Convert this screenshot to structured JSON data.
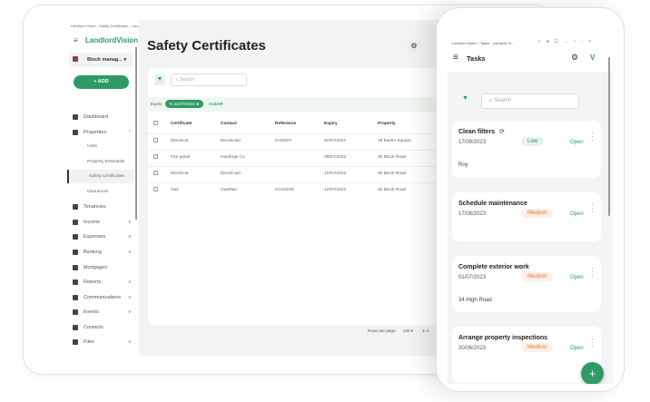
{
  "colors": {
    "accent": "#2f9a66",
    "medium": "#e07a3a"
  },
  "tablet": {
    "window_title": "Landlord Vision - Safety Certificates - Landlord Vision",
    "logo": "LandlordVision",
    "account": "Block manag...",
    "add_label": "+ ADD",
    "sidebar": [
      {
        "label": "Dashboard",
        "icon": "dashboard-icon"
      },
      {
        "label": "Properties",
        "icon": "home-icon",
        "chevron": "^"
      },
      {
        "label": "Income",
        "icon": "income-icon",
        "chevron": "v"
      },
      {
        "label": "Expenses",
        "icon": "expenses-icon",
        "chevron": "v"
      },
      {
        "label": "Banking",
        "icon": "bank-icon",
        "chevron": "v"
      },
      {
        "label": "Mortgages",
        "icon": "mortgage-icon"
      },
      {
        "label": "Reports",
        "icon": "reports-icon",
        "chevron": "v"
      },
      {
        "label": "Communications",
        "icon": "communications-icon",
        "chevron": "v"
      },
      {
        "label": "Events",
        "icon": "calendar-icon",
        "chevron": "v"
      },
      {
        "label": "Contacts",
        "icon": "contacts-icon"
      },
      {
        "label": "Files",
        "icon": "cloud-icon",
        "chevron": "v"
      }
    ],
    "tenancies": "Tenancies",
    "subitems": [
      "Units",
      "Property Essentials",
      "Safety Certificates",
      "Insurances"
    ],
    "page_title": "Safety Certificates",
    "search_placeholder": "Search",
    "filter": {
      "label": "Expiry",
      "chip": "To 31/07/2023",
      "clear": "CLEAR"
    },
    "columns": [
      "Certificate",
      "Contact",
      "Reference",
      "Expiry",
      "Property"
    ],
    "rows": [
      [
        "Electrical",
        "Electrician",
        "KHG567",
        "02/07/2023",
        "18 Martin Square"
      ],
      [
        "Fire panel",
        "Hardings Co",
        "",
        "09/07/2023",
        "35 Block Road"
      ],
      [
        "Electrical",
        "Electrician",
        "",
        "12/07/2023",
        "35 Block Road"
      ],
      [
        "Gas",
        "GasMan",
        "GAS3245",
        "12/07/2023",
        "35 Block Road"
      ]
    ],
    "rows_per_page_label": "Rows per page:",
    "rows_per_page": "100",
    "pagination": "1–4"
  },
  "phone": {
    "window_title": "Landlord Vision - Tasks - Landlord Vi...",
    "title": "Tasks",
    "search_placeholder": "Search",
    "tasks": [
      {
        "name": "Clean filters",
        "date": "17/09/2023",
        "priority": "Low",
        "status": "Open",
        "sub": "Roy",
        "recurring": true
      },
      {
        "name": "Schedule maintenance",
        "date": "17/08/2023",
        "priority": "Medium",
        "status": "Open",
        "sub": ""
      },
      {
        "name": "Complete exterior work",
        "date": "01/07/2023",
        "priority": "Medium",
        "status": "Open",
        "sub": "34 High Road"
      },
      {
        "name": "Arrange property inspections",
        "date": "30/06/2023",
        "priority": "Medium",
        "status": "Open",
        "sub": ""
      }
    ],
    "fab": "+"
  }
}
